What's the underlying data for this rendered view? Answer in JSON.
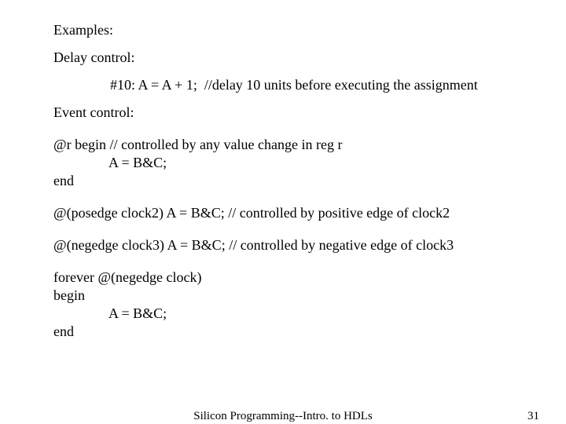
{
  "lines": {
    "examples": "Examples:",
    "delay_control": "Delay control:",
    "delay_example": "#10: A = A + 1;  //delay 10 units before executing the assignment",
    "event_control": "Event control:",
    "r_begin": "@r begin // controlled by any value change in reg r",
    "r_body": "A = B&C;",
    "r_end": "end",
    "posedge": "@(posedge clock2) A = B&C; // controlled by positive edge of clock2",
    "negedge": "@(negedge clock3) A = B&C; // controlled by negative edge of clock3",
    "forever": "forever @(negedge clock)",
    "forever_begin": "begin",
    "forever_body": "A = B&C;",
    "forever_end": "end"
  },
  "footer": {
    "center": "Silicon Programming--Intro. to HDLs",
    "page": "31"
  }
}
